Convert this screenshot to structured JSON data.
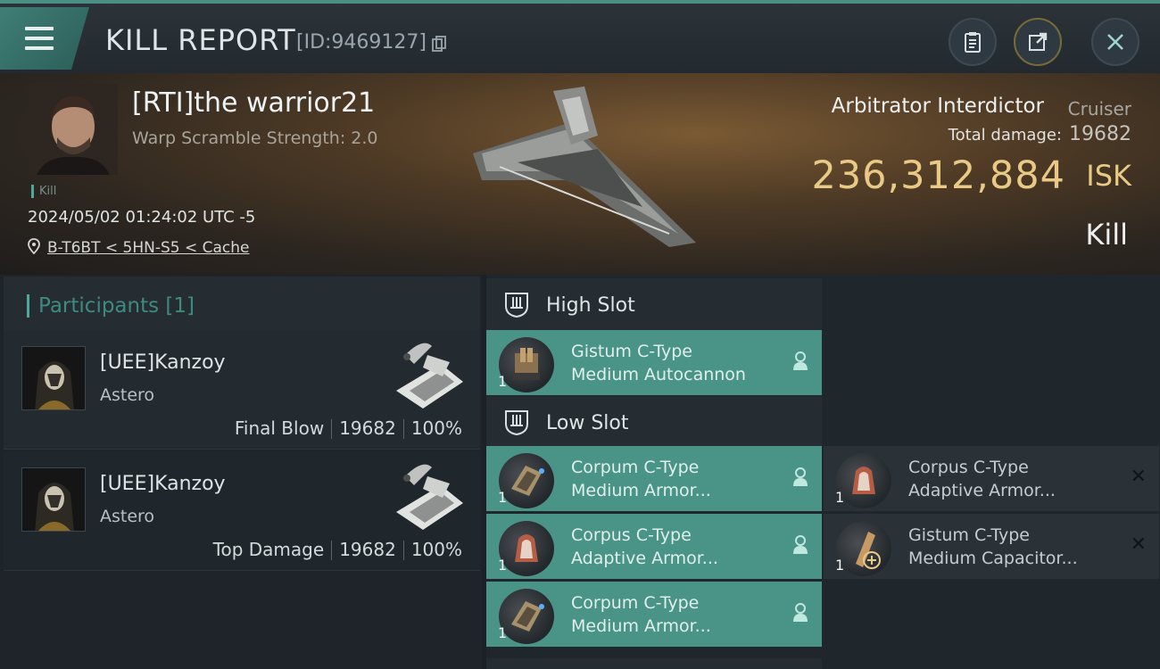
{
  "header": {
    "title": "KILL REPORT",
    "report_id": "[ID:9469127]"
  },
  "victim": {
    "pilot": "[RTI]the warrior21",
    "warp_scramble": "Warp Scramble Strength: 2.0",
    "tag": "Kill",
    "date": "2024/05/02 01:24:02 UTC -5",
    "location": "B-T6BT < 5HN-S5 < Cache",
    "ship_name": "Arbitrator Interdictor",
    "ship_class": "Cruiser",
    "total_damage_label": "Total damage:",
    "total_damage": "19682",
    "isk_value": "236,312,884",
    "isk_unit": "ISK",
    "result": "Kill"
  },
  "participants": {
    "title": "Participants [1]",
    "items": [
      {
        "name": "[UEE]Kanzoy",
        "ship": "Astero",
        "role": "Final Blow",
        "damage": "19682",
        "percent": "100%"
      },
      {
        "name": "[UEE]Kanzoy",
        "ship": "Astero",
        "role": "Top Damage",
        "damage": "19682",
        "percent": "100%"
      }
    ]
  },
  "fitting": {
    "high_slot_label": "High Slot",
    "low_slot_label": "Low Slot",
    "high": [
      {
        "qty": "1",
        "line1": "Gistum C-Type",
        "line2": "Medium Autocannon"
      }
    ],
    "low_fitted": [
      {
        "qty": "1",
        "line1": "Corpum C-Type",
        "line2": "Medium Armor..."
      },
      {
        "qty": "1",
        "line1": "Corpus C-Type",
        "line2": "Adaptive Armor..."
      },
      {
        "qty": "1",
        "line1": "Corpum C-Type",
        "line2": "Medium Armor..."
      }
    ],
    "low_dropped": [
      {
        "qty": "1",
        "line1": "Corpus C-Type",
        "line2": "Adaptive Armor..."
      },
      {
        "qty": "1",
        "line1": "Gistum C-Type",
        "line2": "Medium Capacitor..."
      }
    ]
  },
  "colors": {
    "accent_teal": "#4a9387",
    "isk_gold": "#e8c986"
  },
  "icons": [
    "menu-icon",
    "copy-icon",
    "clipboard-icon",
    "share-icon",
    "close-icon",
    "location-pin-icon",
    "slot-shield-icon",
    "person-icon",
    "x-icon"
  ]
}
